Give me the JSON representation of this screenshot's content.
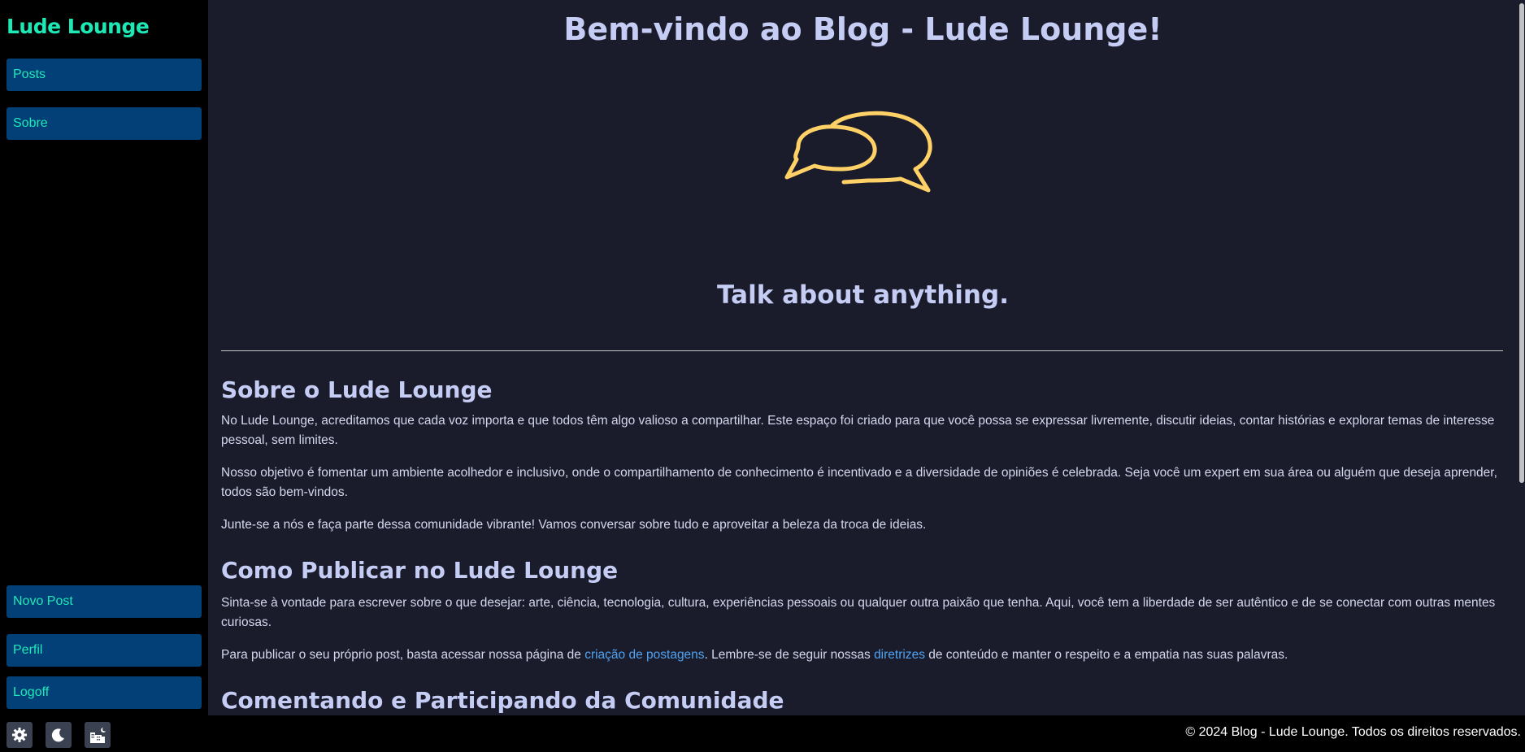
{
  "sidebar": {
    "brand": "Lude Lounge",
    "top_items": [
      {
        "label": "Posts"
      },
      {
        "label": "Sobre"
      }
    ],
    "bottom_items": [
      {
        "label": "Novo Post"
      },
      {
        "label": "Perfil"
      },
      {
        "label": "Logoff"
      }
    ]
  },
  "main": {
    "title": "Bem-vindo ao Blog - Lude Lounge!",
    "hero_icon": "chat-bubbles-icon",
    "tagline": "Talk about anything.",
    "sections": {
      "about_heading": "Sobre o Lude Lounge",
      "about_p1": "No Lude Lounge, acreditamos que cada voz importa e que todos têm algo valioso a compartilhar. Este espaço foi criado para que você possa se expressar livremente, discutir ideias, contar histórias e explorar temas de interesse pessoal, sem limites.",
      "about_p2": "Nosso objetivo é fomentar um ambiente acolhedor e inclusivo, onde o compartilhamento de conhecimento é incentivado e a diversidade de opiniões é celebrada. Seja você um expert em sua área ou alguém que deseja aprender, todos são bem-vindos.",
      "about_p3": "Junte-se a nós e faça parte dessa comunidade vibrante! Vamos conversar sobre tudo e aproveitar a beleza da troca de ideias.",
      "publish_heading": "Como Publicar no Lude Lounge",
      "publish_p1": "Sinta-se à vontade para escrever sobre o que desejar: arte, ciência, tecnologia, cultura, experiências pessoais ou qualquer outra paixão que tenha. Aqui, você tem a liberdade de ser autêntico e de se conectar com outras mentes curiosas.",
      "publish_p2_before": "Para publicar o seu próprio post, basta acessar nossa página de ",
      "publish_p2_link1": "criação de postagens",
      "publish_p2_middle": ". Lembre-se de seguir nossas ",
      "publish_p2_link2": "diretrizes",
      "publish_p2_after": " de conteúdo e manter o respeito e a empatia nas suas palavras.",
      "comment_heading": "Comentando e Participando da Comunidade"
    }
  },
  "footer": {
    "icons": [
      "settings-icon",
      "moon-icon",
      "city-night-icon"
    ],
    "copyright": "© 2024 Blog - Lude Lounge. Todos os direitos reservados."
  },
  "colors": {
    "accent": "#1de9b6",
    "nav_button": "#034078",
    "heading": "#c5cdf5",
    "link": "#4fa3f2",
    "icon_yellow": "#ffd166",
    "background": "#1b1c2b"
  }
}
